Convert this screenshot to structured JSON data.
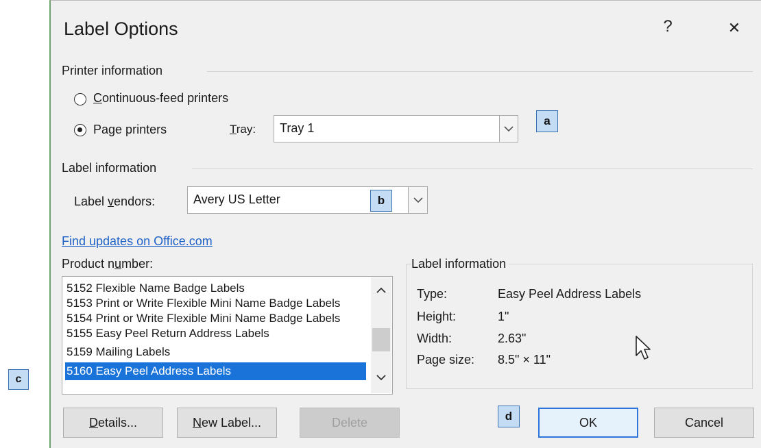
{
  "dialog": {
    "title": "Label Options",
    "help": "?",
    "close": "✕"
  },
  "printer_info": {
    "heading": "Printer information",
    "continuous": {
      "pre": "",
      "key": "C",
      "post": "ontinuous-feed printers",
      "selected": false
    },
    "page": {
      "pre": "Pa",
      "key": "g",
      "post": "e printers",
      "selected": true
    },
    "tray_label": {
      "pre": "",
      "key": "T",
      "post": "ray:"
    },
    "tray_value": "Tray 1"
  },
  "label_info": {
    "heading": "Label information",
    "vendors_label": {
      "pre": "Label ",
      "key": "v",
      "post": "endors:"
    },
    "vendors_value": "Avery US Letter"
  },
  "find_updates": "Find updates on Office.com",
  "product": {
    "label": {
      "pre": "Product n",
      "key": "u",
      "post": "mber:"
    },
    "items": [
      "5152 Flexible Name Badge Labels",
      "5153 Print or Write Flexible Mini Name Badge Labels",
      "5154 Print or Write Flexible Mini Name Badge Labels",
      "5155 Easy Peel Return Address Labels",
      "5159 Mailing Labels",
      "5160 Easy Peel Address Labels"
    ],
    "selected_index": 5
  },
  "details_panel": {
    "heading": "Label information",
    "rows": [
      {
        "key": "Type:",
        "value": "Easy Peel Address Labels"
      },
      {
        "key": "Height:",
        "value": "1\""
      },
      {
        "key": "Width:",
        "value": "2.63\""
      },
      {
        "key": "Page size:",
        "value": "8.5\" × 11\""
      }
    ]
  },
  "buttons": {
    "details": {
      "pre": "",
      "key": "D",
      "post": "etails..."
    },
    "new_label": {
      "pre": "",
      "key": "N",
      "post": "ew Label..."
    },
    "delete": "Delete",
    "ok": "OK",
    "cancel": "Cancel"
  },
  "callouts": {
    "a": "a",
    "b": "b",
    "c": "c",
    "d": "d"
  }
}
